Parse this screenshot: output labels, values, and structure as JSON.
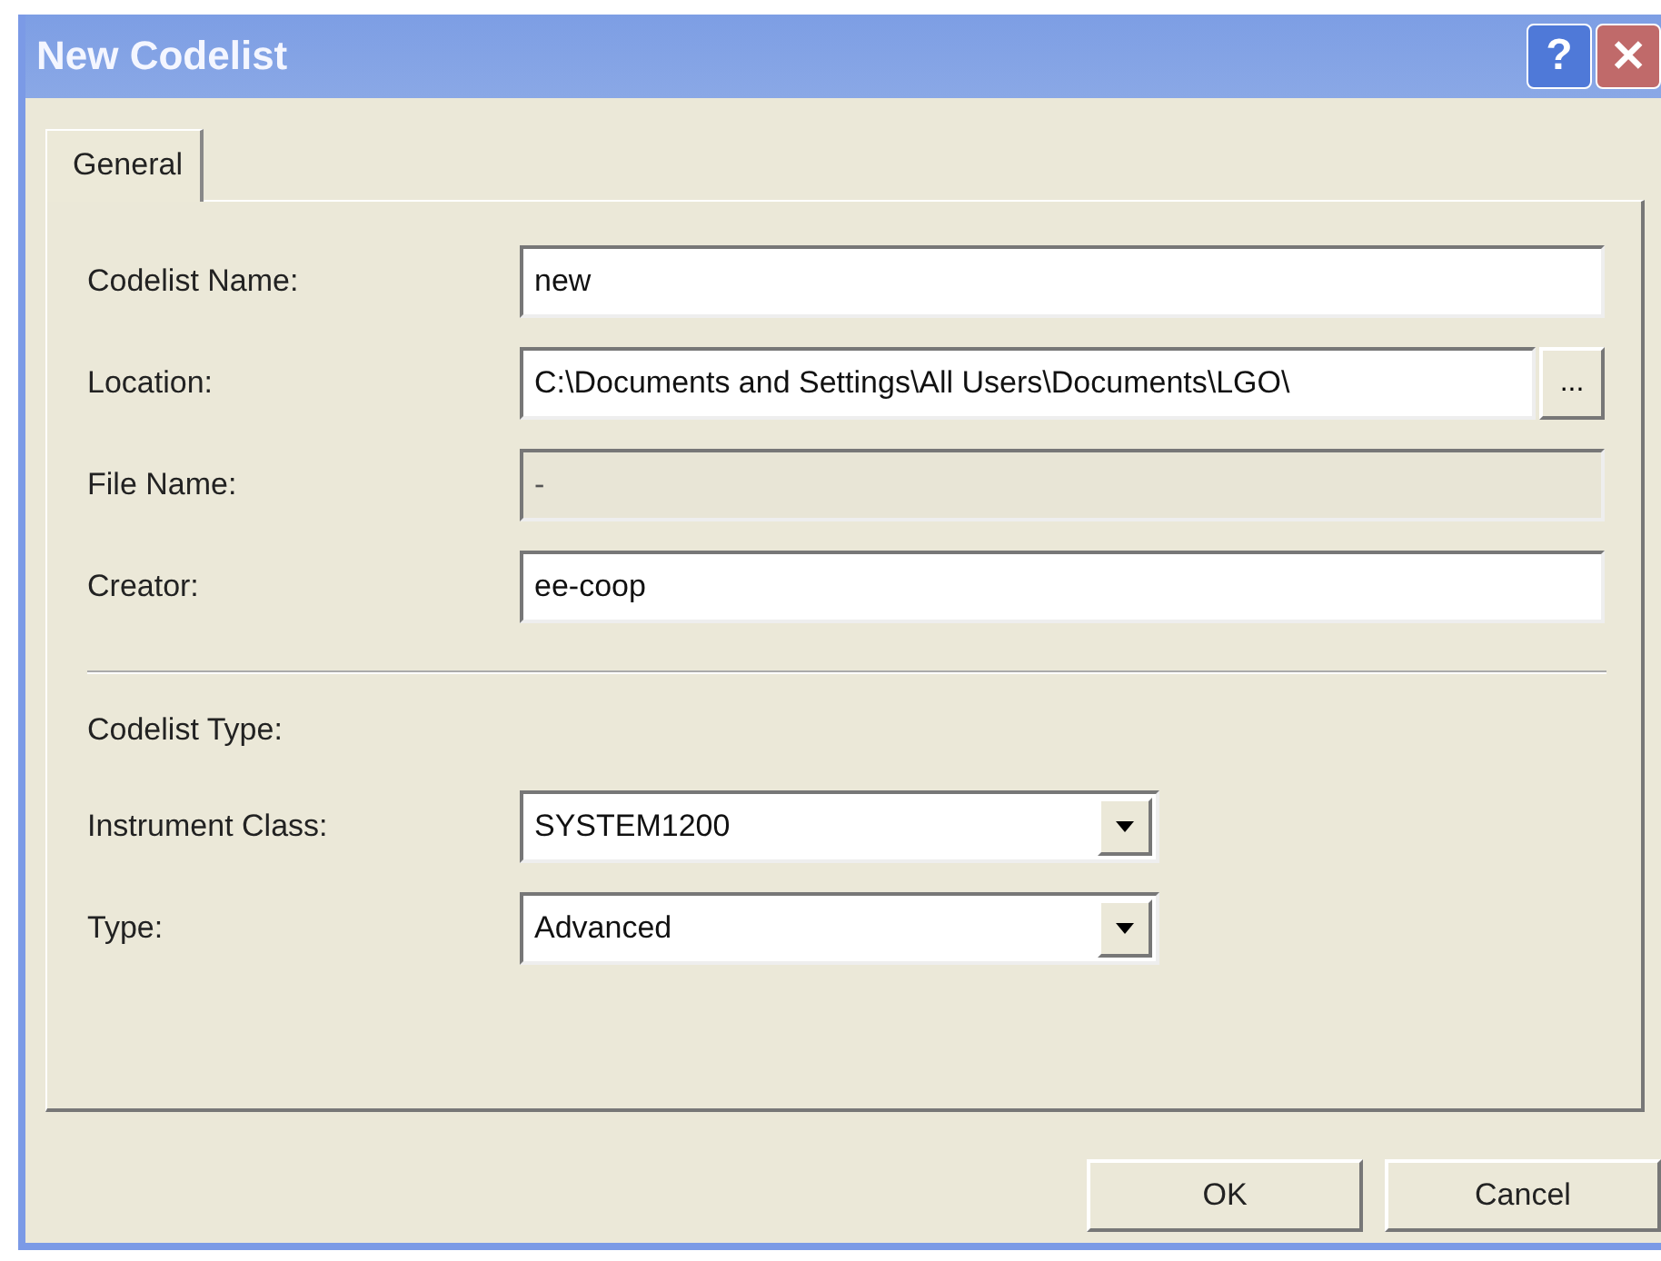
{
  "window": {
    "title": "New Codelist",
    "help_button": "?",
    "close_button": "✕"
  },
  "tabs": [
    {
      "label": "General",
      "selected": true
    }
  ],
  "fields": [
    {
      "label": "Codelist Name:",
      "value": "new",
      "disabled": false
    },
    {
      "label": "Location:",
      "value": "C:\\Documents and Settings\\All Users\\Documents\\LGO\\",
      "disabled": false,
      "browse_button": "..."
    },
    {
      "label": "File Name:",
      "value": "-",
      "disabled": true
    },
    {
      "label": "Creator:",
      "value": "ee-coop",
      "disabled": false
    }
  ],
  "section_label": "Codelist Type:",
  "dropdowns": [
    {
      "label": "Instrument Class:",
      "value": "SYSTEM1200"
    },
    {
      "label": "Type:",
      "value": "Advanced"
    }
  ],
  "buttons": [
    "OK",
    "Cancel"
  ]
}
